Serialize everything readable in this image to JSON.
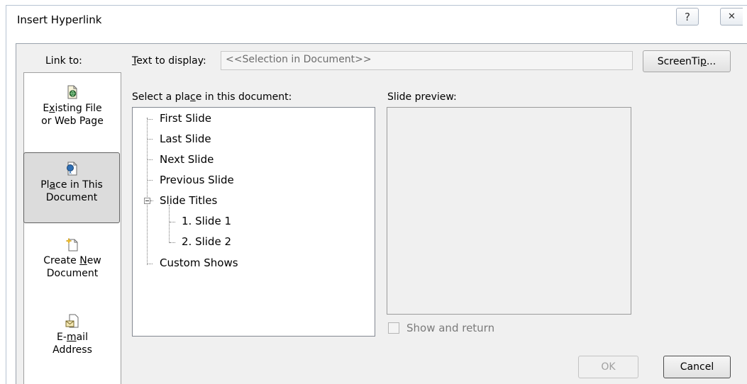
{
  "dialog": {
    "title": "Insert Hyperlink",
    "help_glyph": "?",
    "close_glyph": "✕"
  },
  "link_to": {
    "label": "Link to:",
    "items": [
      {
        "line1_pre": "E",
        "line1_u": "x",
        "line1_post": "isting File",
        "line2": "or Web Page",
        "icon": "existing-file-icon"
      },
      {
        "line1_pre": "Pl",
        "line1_u": "a",
        "line1_post": "ce in This",
        "line2": "Document",
        "icon": "place-in-document-icon"
      },
      {
        "line1_pre": "Create ",
        "line1_u": "N",
        "line1_post": "ew",
        "line2": "Document",
        "icon": "create-new-document-icon"
      },
      {
        "line1_pre": "E-",
        "line1_u": "m",
        "line1_post": "ail",
        "line2": "Address",
        "icon": "email-address-icon"
      }
    ]
  },
  "text_to_display": {
    "label_u": "T",
    "label_rest": "ext to display:",
    "value": "<<Selection in Document>>"
  },
  "screentip": {
    "pre": "ScreenTi",
    "u": "p",
    "post": "..."
  },
  "place": {
    "label_pre": "Select a pla",
    "label_u": "c",
    "label_post": "e in this document:",
    "tree": {
      "first": "First Slide",
      "last": "Last Slide",
      "next": "Next Slide",
      "previous": "Previous Slide",
      "titles": "Slide Titles",
      "slide1": "1. Slide 1",
      "slide2": "2. Slide 2",
      "custom": "Custom Shows"
    }
  },
  "preview": {
    "label": "Slide preview:"
  },
  "show_return": {
    "label": "Show and return",
    "checked": false
  },
  "buttons": {
    "ok": "OK",
    "cancel": "Cancel"
  },
  "colors": {
    "selected_bg": "#dcdcdc",
    "dialog_bg": "#f0f0f0",
    "disabled_text": "#a0a0a0"
  }
}
